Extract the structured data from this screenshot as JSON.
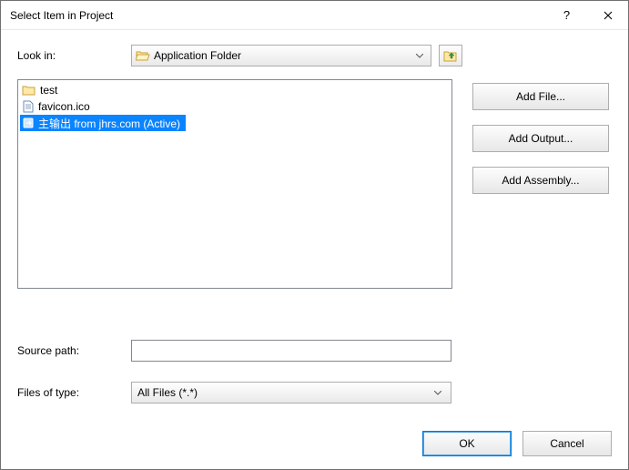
{
  "titlebar": {
    "title": "Select Item in Project"
  },
  "lookin": {
    "label": "Look in:",
    "value": "Application Folder"
  },
  "filelist": {
    "items": [
      {
        "name": "test",
        "icon": "folder",
        "selected": false
      },
      {
        "name": "favicon.ico",
        "icon": "file",
        "selected": false
      },
      {
        "name": "主输出 from jhrs.com (Active)",
        "icon": "output",
        "selected": true
      }
    ]
  },
  "side": {
    "add_file": "Add File...",
    "add_output": "Add Output...",
    "add_assembly": "Add Assembly..."
  },
  "source": {
    "label": "Source path:",
    "value": ""
  },
  "filetype": {
    "label": "Files of type:",
    "value": "All Files (*.*)"
  },
  "footer": {
    "ok": "OK",
    "cancel": "Cancel"
  }
}
